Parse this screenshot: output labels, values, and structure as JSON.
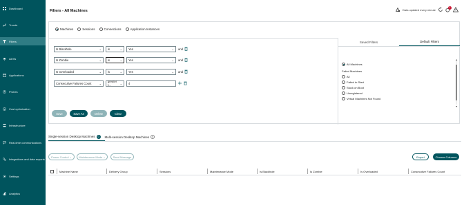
{
  "sidebar": {
    "items": [
      {
        "label": "Dashboard",
        "icon": "dashboard-icon"
      },
      {
        "label": "Trends",
        "icon": "trends-icon"
      },
      {
        "label": "Filters",
        "icon": "filter-icon",
        "active": true
      },
      {
        "label": "Alerts",
        "icon": "bell-icon"
      },
      {
        "label": "Applications",
        "icon": "applications-icon"
      },
      {
        "label": "Probes",
        "icon": "probe-icon"
      },
      {
        "label": "Cost optimization",
        "icon": "cost-icon"
      },
      {
        "label": "Infrastructure",
        "icon": "infrastructure-icon"
      },
      {
        "label": "Real-time communications",
        "icon": "communications-icon"
      },
      {
        "label": "Integrations and data exports",
        "icon": "integrations-icon"
      },
      {
        "label": "Settings",
        "icon": "gear-icon"
      },
      {
        "label": "Analytics",
        "icon": "analytics-icon"
      }
    ]
  },
  "header": {
    "title": "Filters - All Machines",
    "data_updated": "Data updated every minute",
    "notification_count": "1"
  },
  "filter_types": {
    "options": [
      "Machines",
      "Sessions",
      "Connections",
      "Application Instances"
    ],
    "selected": "Machines"
  },
  "filter_rows": [
    {
      "field": "Is Blackhole",
      "operator": "is",
      "value": "Yes",
      "joiner": "and"
    },
    {
      "field": "Is Zombie",
      "operator": "is",
      "value": "Yes",
      "joiner": "and"
    },
    {
      "field": "Is Overloaded",
      "operator": "is",
      "value": "Yes",
      "joiner": "and"
    },
    {
      "field": "Consecutive Failures Count",
      "operator": "greater t...",
      "value": "4",
      "joiner": ""
    }
  ],
  "actions": {
    "save": "Save",
    "save_as": "Save As",
    "delete": "Delete",
    "clear": "Clear"
  },
  "saved_panel": {
    "tabs": [
      "Saved Filters",
      "Default Filters"
    ],
    "active_tab": "Default Filters",
    "all_machines": "All Machines",
    "group_label": "Failed Machines",
    "items": [
      "All",
      "Failed to Start",
      "Stuck on Boot",
      "Unregistered",
      "Virtual Machines Not Found"
    ]
  },
  "session_tabs": [
    {
      "label": "Single-session Desktop Machines",
      "count": "0"
    },
    {
      "label": "Multi-session Desktop Machines",
      "count": "0"
    }
  ],
  "toolbar": {
    "power_control": "Power Control",
    "maintenance_mode": "Maintenance Mode",
    "send_message": "Send Message",
    "export": "Export",
    "choose_columns": "Choose Columns"
  },
  "table": {
    "columns": [
      "Machine Name",
      "Delivery Group",
      "Sessions",
      "Maintenance Mode",
      "Is Blackhole",
      "Is Zombie",
      "Is Overloaded",
      "Consecutive Failures Count"
    ]
  },
  "colors": {
    "accent": "#00545d",
    "sidebar_bg": "#00545d",
    "active_nav": "#2f7c84",
    "badge": "#c8102e"
  }
}
